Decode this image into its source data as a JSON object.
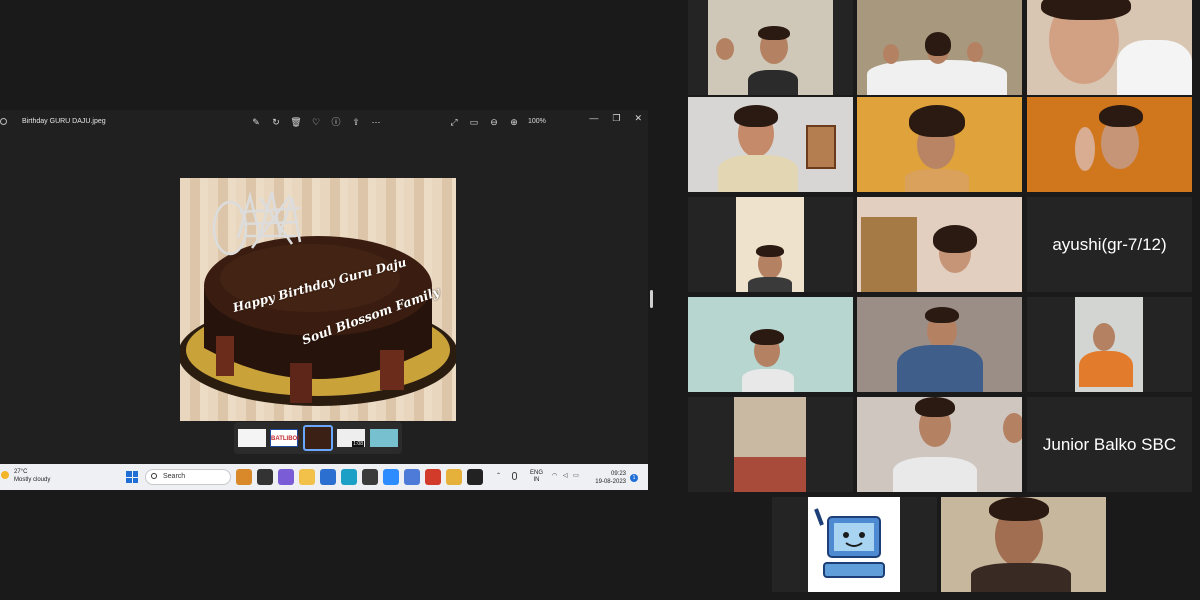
{
  "viewer": {
    "filename": "Birthday GURU DAJU.jpeg",
    "zoom_level": "100%",
    "toolbar_icons": [
      "edit-icon",
      "rotate-icon",
      "delete-icon",
      "heart-icon",
      "info-icon",
      "share-icon",
      "more-icon"
    ],
    "cake_text_line1": "Happy Birthday Guru Daju",
    "cake_text_line2": "Soul Blossom Family",
    "filmstrip": {
      "thumb2_text": "BATLIBOI",
      "thumb4_duration": "1:08"
    }
  },
  "taskbar": {
    "weather_temp": "27°C",
    "weather_desc": "Mostly cloudy",
    "search_placeholder": "Search",
    "language": "ENG",
    "region": "IN",
    "time": "09:23",
    "date": "19-08-2023",
    "notification_count": "1"
  },
  "gallery": {
    "named_tiles": [
      {
        "label": "ayushi(gr-7/12)"
      },
      {
        "label": "Junior Balko SBC"
      }
    ]
  },
  "colors": {
    "background": "#1a1a1a",
    "active_speaker": "#58c447",
    "taskbar": "#eef0f4"
  }
}
